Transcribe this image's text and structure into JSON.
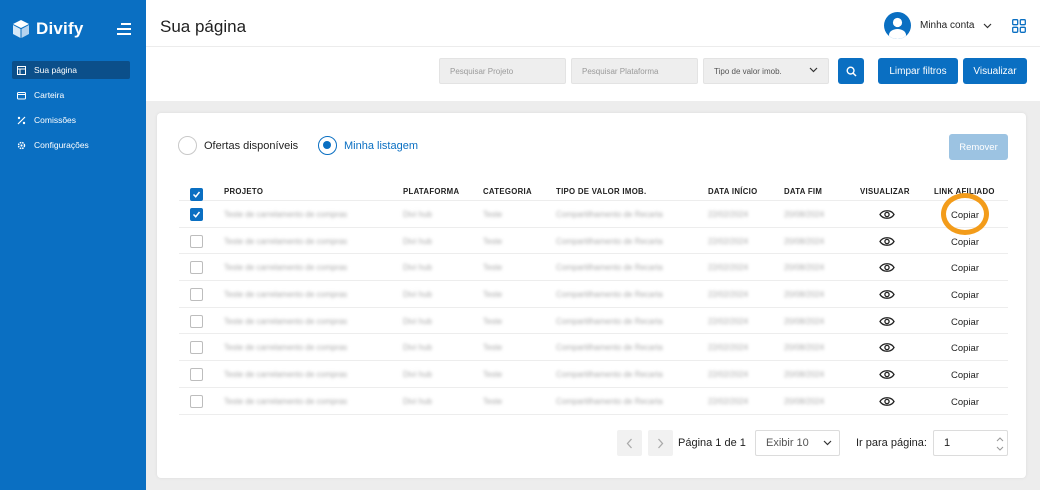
{
  "app": {
    "name": "Divify"
  },
  "sidebar": {
    "items": [
      {
        "label": "Sua página",
        "icon": "dashboard-icon",
        "active": true
      },
      {
        "label": "Carteira",
        "icon": "wallet-icon",
        "active": false
      },
      {
        "label": "Comissões",
        "icon": "percent-icon",
        "active": false
      },
      {
        "label": "Configurações",
        "icon": "gear-icon",
        "active": false
      }
    ]
  },
  "header": {
    "title": "Sua página",
    "account_label": "Minha conta"
  },
  "filters": {
    "project_placeholder": "Pesquisar Projeto",
    "platform_placeholder": "Pesquisar Plataforma",
    "value_type_label": "Tipo de valor imob.",
    "clear_label": "Limpar filtros",
    "view_label": "Visualizar"
  },
  "tabs": {
    "available_label": "Ofertas disponíveis",
    "mine_label": "Minha listagem",
    "selected": "mine"
  },
  "remove_label": "Remover",
  "table": {
    "columns": [
      "PROJETO",
      "PLATAFORMA",
      "CATEGORIA",
      "TIPO DE VALOR IMOB.",
      "DATA INÍCIO",
      "DATA FIM",
      "VISUALIZAR",
      "LINK AFILIADO"
    ],
    "rows": [
      {
        "checked": true,
        "projeto": "Teste de carrelamento de compras",
        "plataforma": "Divi hub",
        "categoria": "Teste",
        "tipo": "Compartilhamento de Recarta",
        "inicio": "22/02/2024",
        "fim": "20/08/2024",
        "link": "Copiar"
      },
      {
        "checked": false,
        "projeto": "Teste de carrelamento de compras",
        "plataforma": "Divi hub",
        "categoria": "Teste",
        "tipo": "Compartilhamento de Recarta",
        "inicio": "22/02/2024",
        "fim": "20/08/2024",
        "link": "Copiar"
      },
      {
        "checked": false,
        "projeto": "Teste de carrelamento de compras",
        "plataforma": "Divi hub",
        "categoria": "Teste",
        "tipo": "Compartilhamento de Recarta",
        "inicio": "22/02/2024",
        "fim": "20/08/2024",
        "link": "Copiar"
      },
      {
        "checked": false,
        "projeto": "Teste de carrelamento de compras",
        "plataforma": "Divi hub",
        "categoria": "Teste",
        "tipo": "Compartilhamento de Recarta",
        "inicio": "22/02/2024",
        "fim": "20/08/2024",
        "link": "Copiar"
      },
      {
        "checked": false,
        "projeto": "Teste de carrelamento de compras",
        "plataforma": "Divi hub",
        "categoria": "Teste",
        "tipo": "Compartilhamento de Recarta",
        "inicio": "22/02/2024",
        "fim": "20/08/2024",
        "link": "Copiar"
      },
      {
        "checked": false,
        "projeto": "Teste de carrelamento de compras",
        "plataforma": "Divi hub",
        "categoria": "Teste",
        "tipo": "Compartilhamento de Recarta",
        "inicio": "22/02/2024",
        "fim": "20/08/2024",
        "link": "Copiar"
      },
      {
        "checked": false,
        "projeto": "Teste de carrelamento de compras",
        "plataforma": "Divi hub",
        "categoria": "Teste",
        "tipo": "Compartilhamento de Recarta",
        "inicio": "22/02/2024",
        "fim": "20/08/2024",
        "link": "Copiar"
      },
      {
        "checked": false,
        "projeto": "Teste de carrelamento de compras",
        "plataforma": "Divi hub",
        "categoria": "Teste",
        "tipo": "Compartilhamento de Recarta",
        "inicio": "22/02/2024",
        "fim": "20/08/2024",
        "link": "Copiar"
      }
    ]
  },
  "pagination": {
    "page_text": "Página 1 de 1",
    "per_page_label": "Exibir 10",
    "goto_label": "Ir para página:",
    "goto_value": "1"
  },
  "colors": {
    "brand": "#0a6fc2",
    "highlight": "#f39c1a"
  }
}
